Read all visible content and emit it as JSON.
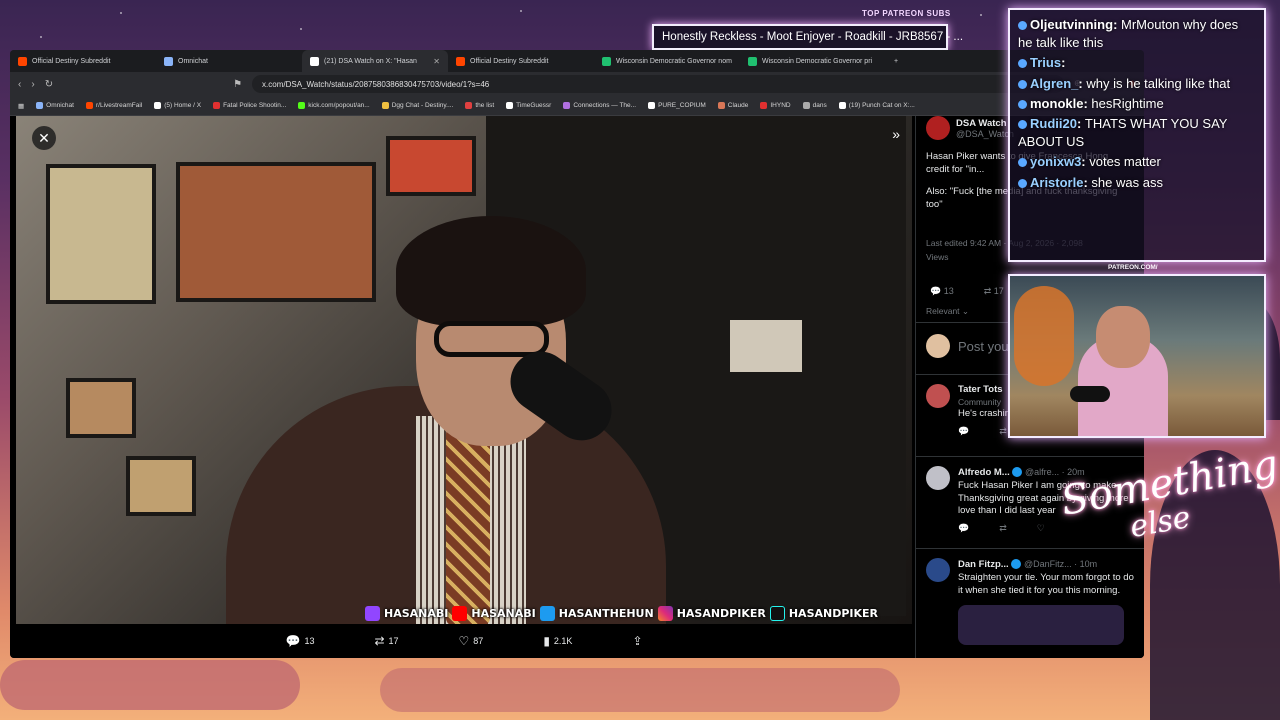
{
  "browser": {
    "tabs": [
      {
        "label": "Official Destiny Subreddit",
        "color": "#ff4500"
      },
      {
        "label": "Omnichat",
        "color": "#8ab4f8"
      },
      {
        "label": "(21) DSA Watch on X: \"Hasan",
        "color": "#ffffff",
        "active": true
      },
      {
        "label": "Official Destiny Subreddit",
        "color": "#ff4500"
      },
      {
        "label": "Wisconsin Democratic Governor nom",
        "color": "#20c070"
      },
      {
        "label": "Wisconsin Democratic Governor pri",
        "color": "#20c070"
      }
    ],
    "url": "x.com/DSA_Watch/status/2087580386830475703/video/1?s=46",
    "bookmarks": [
      {
        "label": "Omnichat",
        "color": "#8ab4f8"
      },
      {
        "label": "r/LivestreamFail",
        "color": "#ff4500"
      },
      {
        "label": "(5) Home / X",
        "color": "#ffffff"
      },
      {
        "label": "Fatal Police Shootin...",
        "color": "#e03030"
      },
      {
        "label": "kick.com/popout/an...",
        "color": "#53fc18"
      },
      {
        "label": "Dgg Chat - Destiny....",
        "color": "#f0c040"
      },
      {
        "label": "the list",
        "color": "#e04040"
      },
      {
        "label": "TimeGuessr",
        "color": "#ffffff"
      },
      {
        "label": "Connections — The...",
        "color": "#b070e0"
      },
      {
        "label": "PURE_COPIUM",
        "color": "#ffffff"
      },
      {
        "label": "Claude",
        "color": "#d97757"
      },
      {
        "label": "IHYND",
        "color": "#e03030"
      },
      {
        "label": "dans",
        "color": "#aaaaaa"
      },
      {
        "label": "(19) Punch Cat on X:...",
        "color": "#ffffff"
      }
    ]
  },
  "video": {
    "socials": [
      "HASANABI",
      "HASANABI",
      "HASANTHEHUN",
      "HASANDPIKER",
      "HASANDPIKER"
    ],
    "actions": {
      "replies": "13",
      "reposts": "17",
      "likes": "87",
      "views": "2.1K"
    }
  },
  "tweet": {
    "author": "DSA Watch",
    "handle": "@DSA_Watch",
    "text1": "Hasan Piker wants to give Francesca Hong credit for \"in...",
    "text2": "Also: \"Fuck [the media] and fuck thanksgiving too\"",
    "edited": "Last edited 9:42 AM · Aug 2, 2026 · 2,098",
    "views_label": "Views",
    "replies": "13",
    "reposts": "17",
    "relevant": "Relevant",
    "post_placeholder": "Post your reply",
    "replies_list": [
      {
        "name": "Tater Tots",
        "sub": "Community",
        "text": "He's crashing"
      },
      {
        "name": "Alfredo M...",
        "handle": "@alfre... · 20m",
        "text": "Fuck Hasan Piker I am going to make Thanksgiving great again by giving more love than I did last year"
      },
      {
        "name": "Dan Fitzp...",
        "handle": "@DanFitz... · 10m",
        "text": "Straighten your tie. Your mom forgot to do it when she tied it for you this morning."
      }
    ]
  },
  "overlay": {
    "patreon_title": "TOP PATREON SUBS",
    "sub_banner": "Honestly Reckless - Moot Enjoyer - Roadkill - JRB8567 - ...",
    "patreon_url": "PATREON.COM/",
    "signature_main": "Something",
    "signature_sub": "else",
    "chat": [
      {
        "user": "Oljeutvinning",
        "user_color": "#ffffff",
        "text": "MrMouton why does he talk like this"
      },
      {
        "user": "Trius",
        "user_color": "#9ad0ff",
        "text": ""
      },
      {
        "user": "Algren_",
        "user_color": "#9ad0ff",
        "text": "why is he talking like that"
      },
      {
        "user": "monokle",
        "user_color": "#ffffff",
        "text": "hesRightime"
      },
      {
        "user": "Rudii20",
        "user_color": "#9ad0ff",
        "text": "THATS WHAT YOU SAY ABOUT US"
      },
      {
        "user": "yonixw3",
        "user_color": "#9ad0ff",
        "text": "votes matter"
      },
      {
        "user": "Aristorle",
        "user_color": "#9ad0ff",
        "text": "she was ass"
      }
    ]
  }
}
